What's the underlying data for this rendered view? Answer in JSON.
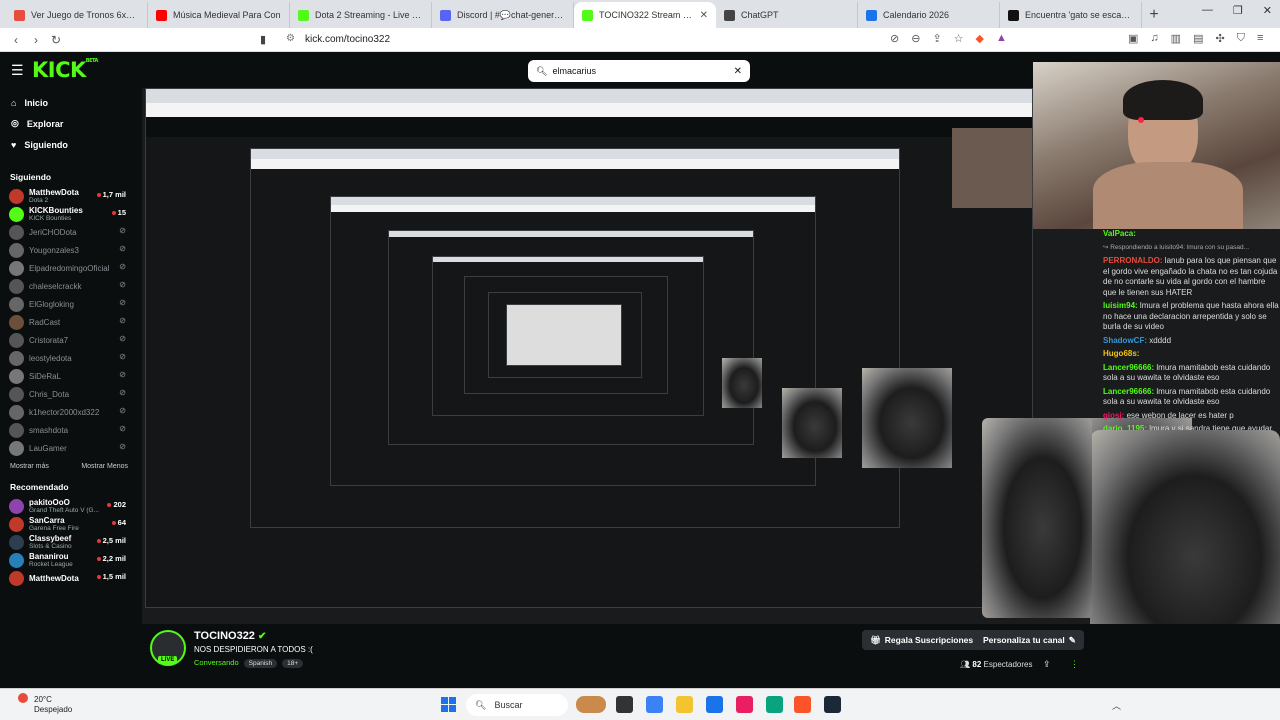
{
  "browser": {
    "tabs": [
      {
        "label": "Ver Juego de Tronos 6x10 Onli",
        "color": "#e74c3c",
        "active": false
      },
      {
        "label": "Música Medieval Para Con",
        "color": "#ff0000",
        "active": false
      },
      {
        "label": "Dota 2 Streaming - Live Stream",
        "color": "#53fc18",
        "active": false
      },
      {
        "label": "Discord | #💬chat-general |",
        "color": "#5865f2",
        "active": false
      },
      {
        "label": "TOCINO322 Stream - V",
        "color": "#53fc18",
        "active": true
      },
      {
        "label": "ChatGPT",
        "color": "#444444",
        "active": false
      },
      {
        "label": "Calendario 2026",
        "color": "#1a73e8",
        "active": false
      },
      {
        "label": "Encuentra 'gato se escapa' en",
        "color": "#111111",
        "active": false
      }
    ],
    "url": "kick.com/tocino322"
  },
  "kick": {
    "logo": "KICK",
    "logo_badge": "BETA",
    "search_value": "elmacarius",
    "nav": [
      {
        "label": "Inicio",
        "icon": "home-icon"
      },
      {
        "label": "Explorar",
        "icon": "compass-icon"
      },
      {
        "label": "Siguiendo",
        "icon": "heart-icon"
      }
    ],
    "following_title": "Siguiendo",
    "following": [
      {
        "name": "MatthewDota",
        "sub": "Dota 2",
        "viewers": "1,7 mil",
        "live": true,
        "color": "#c0392b"
      },
      {
        "name": "KICKBounties",
        "sub": "KICK Bounties",
        "viewers": "15",
        "live": true,
        "color": "#53fc18"
      },
      {
        "name": "JeriCHODota",
        "sub": "",
        "viewers": "",
        "live": false,
        "color": "#555"
      },
      {
        "name": "Yougonzales3",
        "sub": "",
        "viewers": "",
        "live": false,
        "color": "#666"
      },
      {
        "name": "ElpadredomingoOficial",
        "sub": "",
        "viewers": "",
        "live": false,
        "color": "#777"
      },
      {
        "name": "chaleselcrackk",
        "sub": "",
        "viewers": "",
        "live": false,
        "color": "#555"
      },
      {
        "name": "ElGlogloking",
        "sub": "",
        "viewers": "",
        "live": false,
        "color": "#666"
      },
      {
        "name": "RadCast",
        "sub": "",
        "viewers": "",
        "live": false,
        "color": "#6b4f3a"
      },
      {
        "name": "Cristorata7",
        "sub": "",
        "viewers": "",
        "live": false,
        "color": "#555"
      },
      {
        "name": "leostyledota",
        "sub": "",
        "viewers": "",
        "live": false,
        "color": "#666"
      },
      {
        "name": "SiDeRaL",
        "sub": "",
        "viewers": "",
        "live": false,
        "color": "#777"
      },
      {
        "name": "Chris_Dota",
        "sub": "",
        "viewers": "",
        "live": false,
        "color": "#555"
      },
      {
        "name": "k1hector2000xd322",
        "sub": "",
        "viewers": "",
        "live": false,
        "color": "#666"
      },
      {
        "name": "smashdota",
        "sub": "",
        "viewers": "",
        "live": false,
        "color": "#555"
      },
      {
        "name": "LauGamer",
        "sub": "",
        "viewers": "",
        "live": false,
        "color": "#777"
      }
    ],
    "show_more": "Mostrar más",
    "show_less": "Mostrar Menos",
    "recommended_title": "Recomendado",
    "recommended": [
      {
        "name": "pakitoOoO",
        "sub": "Grand Theft Auto V (G...",
        "viewers": "202",
        "color": "#8e44ad"
      },
      {
        "name": "SanCarra",
        "sub": "Garena Free Fire",
        "viewers": "64",
        "color": "#c0392b"
      },
      {
        "name": "Classybeef",
        "sub": "Slots & Casino",
        "viewers": "2,5 mil",
        "color": "#2c3e50"
      },
      {
        "name": "Bananirou",
        "sub": "Rocket League",
        "viewers": "2,2 mil",
        "color": "#2980b9"
      },
      {
        "name": "MatthewDota",
        "sub": "",
        "viewers": "1,5 mil",
        "color": "#c0392b"
      }
    ]
  },
  "chat": [
    {
      "user": "ValPaca:",
      "color": "#53fc18",
      "text": "",
      "reply": ""
    },
    {
      "user": "",
      "color": "#aaa",
      "text": "",
      "reply": "↪ Respondiendo a luisito94: lmura con su pasad..."
    },
    {
      "user": "PERRONALDO:",
      "color": "#e74c3c",
      "text": "lanub para los que piensan que el gordo vive engañado la chata no es tan cojuda de no contarle su vida al gordo con el hambre que le tienen sus HATER",
      "reply": ""
    },
    {
      "user": "luisim94:",
      "color": "#53fc18",
      "text": "lmura el problema que hasta ahora ella no hace una declaracion arrepentida y solo se burla de su video",
      "reply": ""
    },
    {
      "user": "ShadowCF:",
      "color": "#3498db",
      "text": "xdddd",
      "reply": ""
    },
    {
      "user": "Hugo68s:",
      "color": "#f1c40f",
      "text": "",
      "reply": ""
    },
    {
      "user": "Lancer96666:",
      "color": "#53fc18",
      "text": "lmura mamitabob esta cuidando sola a su wawita te olvidaste eso",
      "reply": ""
    },
    {
      "user": "Lancer96666:",
      "color": "#53fc18",
      "text": "lmura mamitabob esta cuidando sola a su wawita te olvidaste eso",
      "reply": ""
    },
    {
      "user": "giosj:",
      "color": "#e91e63",
      "text": "ese webon de lacer es hater p",
      "reply": ""
    },
    {
      "user": "dario_1195:",
      "color": "#53fc18",
      "text": "lmura y si sandra tiene que ayudar",
      "reply": ""
    }
  ],
  "stream": {
    "streamer": "TOCINO322",
    "live_label": "LIVE",
    "title": "NOS DESPIDIERON A TODOS :(",
    "category": "Conversando",
    "tags": [
      "Spanish",
      "18+"
    ],
    "gift_label": "Regala Suscripciones",
    "customize_label": "Personaliza tu canal",
    "viewers_count": "82",
    "viewers_label": "Espectadores"
  },
  "taskbar": {
    "temp": "20°C",
    "weather": "Despejado",
    "search_label": "Buscar",
    "apps": [
      {
        "name": "cat-app-icon",
        "color": "#c98a4b"
      },
      {
        "name": "file-icon",
        "color": "#333333"
      },
      {
        "name": "copilot-icon",
        "color": "#3b82f6"
      },
      {
        "name": "folder-icon",
        "color": "#f4c430"
      },
      {
        "name": "store-icon",
        "color": "#1a73e8"
      },
      {
        "name": "opera-icon",
        "color": "#e91e63"
      },
      {
        "name": "edge-icon",
        "color": "#0aa37f"
      },
      {
        "name": "brave-icon",
        "color": "#fb542b"
      },
      {
        "name": "steam-icon",
        "color": "#1b2838"
      }
    ]
  },
  "colors": {
    "accent": "#53fc18",
    "background": "#0b0e0f"
  }
}
